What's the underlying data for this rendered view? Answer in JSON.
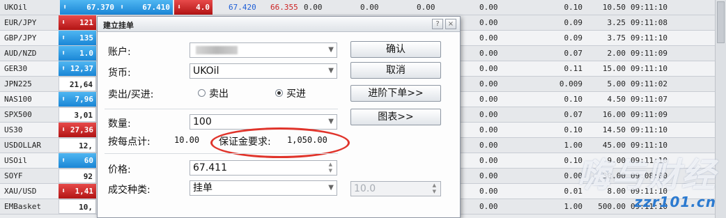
{
  "header_row": {
    "symbol": "UKOil",
    "bid": "67.370",
    "ask": "67.410",
    "spread": "4.0",
    "high": "67.420",
    "low": "66.355",
    "v1": "0.00",
    "v2": "0.00",
    "v3": "0.00"
  },
  "rows": [
    {
      "symbol": "UKOil",
      "bid": "",
      "d1": "0.00",
      "d2": "0.10",
      "d3": "10.50",
      "time": "09:11:10"
    },
    {
      "symbol": "EUR/JPY",
      "bid": "121",
      "dir": "down",
      "d1": "0.00",
      "d2": "0.09",
      "d3": "3.25",
      "time": "09:11:08"
    },
    {
      "symbol": "GBP/JPY",
      "bid": "135",
      "dir": "up",
      "d1": "0.00",
      "d2": "0.09",
      "d3": "3.75",
      "time": "09:11:10"
    },
    {
      "symbol": "AUD/NZD",
      "bid": "1.0",
      "dir": "up",
      "d1": "0.00",
      "d2": "0.07",
      "d3": "2.00",
      "time": "09:11:09"
    },
    {
      "symbol": "GER30",
      "bid": "12,37",
      "dir": "up",
      "d1": "0.00",
      "d2": "0.11",
      "d3": "15.00",
      "time": "09:11:10"
    },
    {
      "symbol": "JPN225",
      "bid": "21,64",
      "dir": "flat",
      "d1": "0.00",
      "d2": "0.009",
      "d3": "5.00",
      "time": "09:11:02"
    },
    {
      "symbol": "NAS100",
      "bid": "7,96",
      "dir": "up",
      "d1": "0.00",
      "d2": "0.10",
      "d3": "4.50",
      "time": "09:11:07"
    },
    {
      "symbol": "SPX500",
      "bid": "3,01",
      "dir": "flat",
      "d1": "0.00",
      "d2": "0.07",
      "d3": "16.00",
      "time": "09:11:09"
    },
    {
      "symbol": "US30",
      "bid": "27,36",
      "dir": "down",
      "d1": "0.00",
      "d2": "0.10",
      "d3": "14.50",
      "time": "09:11:10"
    },
    {
      "symbol": "USDOLLAR",
      "bid": "12,",
      "dir": "flat",
      "d1": "0.00",
      "d2": "1.00",
      "d3": "45.00",
      "time": "09:11:10"
    },
    {
      "symbol": "USOil",
      "bid": "60",
      "dir": "up",
      "d1": "0.00",
      "d2": "0.10",
      "d3": "9.00",
      "time": "09:11:10"
    },
    {
      "symbol": "SOYF",
      "bid": "92",
      "dir": "flat",
      "d1": "0.00",
      "d2": "0.00",
      "d3": "30.00",
      "time": "09:08:00"
    },
    {
      "symbol": "XAU/USD",
      "bid": "1,41",
      "dir": "down",
      "d1": "0.00",
      "d2": "0.01",
      "d3": "8.00",
      "time": "09:11:10"
    },
    {
      "symbol": "EMBasket",
      "bid": "10,",
      "dir": "flat",
      "d1": "0.00",
      "d2": "1.00",
      "d3": "500.00",
      "time": "09:11:10"
    }
  ],
  "dialog": {
    "title": "建立挂单",
    "help_icon": "?",
    "close_icon": "×",
    "account_label": "账户:",
    "currency_label": "货币:",
    "currency_value": "UKOil",
    "side_label": "卖出/买进:",
    "sell_label": "卖出",
    "buy_label": "买进",
    "quantity_label": "数量:",
    "quantity_value": "100",
    "point_value_label": "按每点计:",
    "point_value": "10.00",
    "margin_label": "保证金要求:",
    "margin_value": "1,050.00",
    "price_label": "价格:",
    "price_value": "67.411",
    "order_type_label": "成交种类:",
    "order_type_value": "挂单",
    "extra_value": "10.0",
    "confirm_button": "确认",
    "cancel_button": "取消",
    "advanced_button": "进阶下单>>",
    "chart_button": "图表>>"
  },
  "watermark": {
    "big": "嗨与财经",
    "small": "zzr101.cn"
  }
}
